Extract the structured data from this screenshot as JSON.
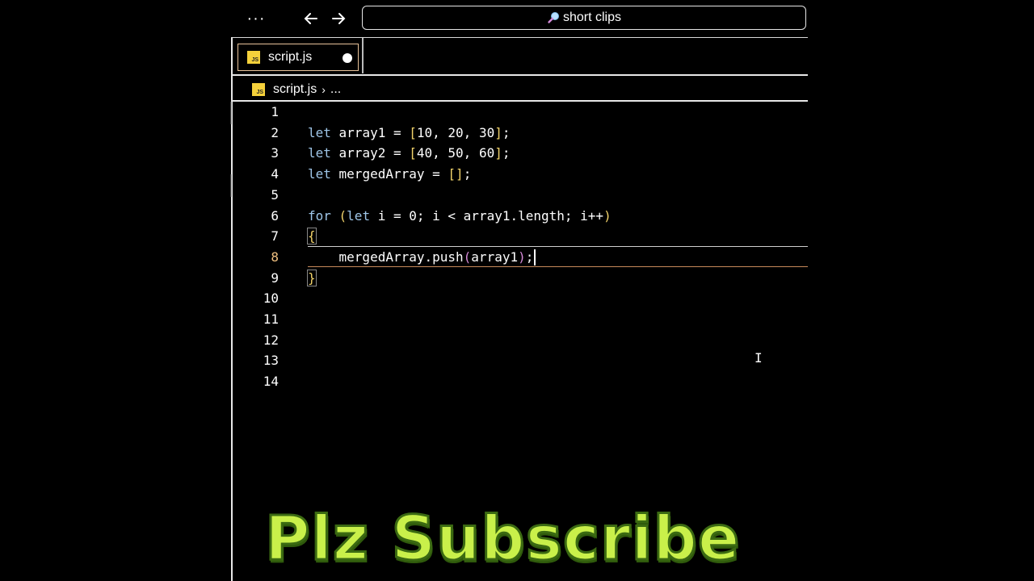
{
  "topbar": {
    "more_label": "···",
    "search_text": "short clips",
    "icons": [
      "more-icon",
      "arrow-left-icon",
      "arrow-right-icon",
      "search-icon"
    ]
  },
  "tab": {
    "label": "script.js",
    "js_badge": "JS",
    "modified": true
  },
  "breadcrumb": {
    "file": "script.js",
    "separator": "›",
    "rest": "..."
  },
  "editor": {
    "active_line": 8,
    "line_numbers": [
      "1",
      "2",
      "3",
      "4",
      "5",
      "6",
      "7",
      "8",
      "9",
      "10",
      "11",
      "12",
      "13",
      "14"
    ],
    "lines": {
      "l2": {
        "kw": "let",
        "rest": " array1 = ",
        "open": "[",
        "vals": "10, 20, 30",
        "close": "]",
        "end": ";"
      },
      "l3": {
        "kw": "let",
        "rest": " array2 = ",
        "open": "[",
        "vals": "40, 50, 60",
        "close": "]",
        "end": ";"
      },
      "l4": {
        "kw": "let",
        "rest": " mergedArray = ",
        "open": "[",
        "close": "]",
        "end": ";"
      },
      "l6": {
        "kw1": "for",
        "open": " (",
        "kw2": "let",
        "rest": " i = 0; i < array1.length; i++",
        "close": ")"
      },
      "l7": {
        "brace": "{"
      },
      "l8": {
        "indent": "    ",
        "call": "mergedArray.push",
        "open": "(",
        "arg": "array1",
        "close": ")",
        "end": ";"
      },
      "l9": {
        "brace": "}"
      }
    }
  },
  "overlay": {
    "subscribe_text": "Plz Subscribe"
  },
  "colors": {
    "keyword": "#9fc6e8",
    "bracket": "#f2d36a",
    "paren": "#d58ad8",
    "subscribe": "#c9f04a"
  }
}
